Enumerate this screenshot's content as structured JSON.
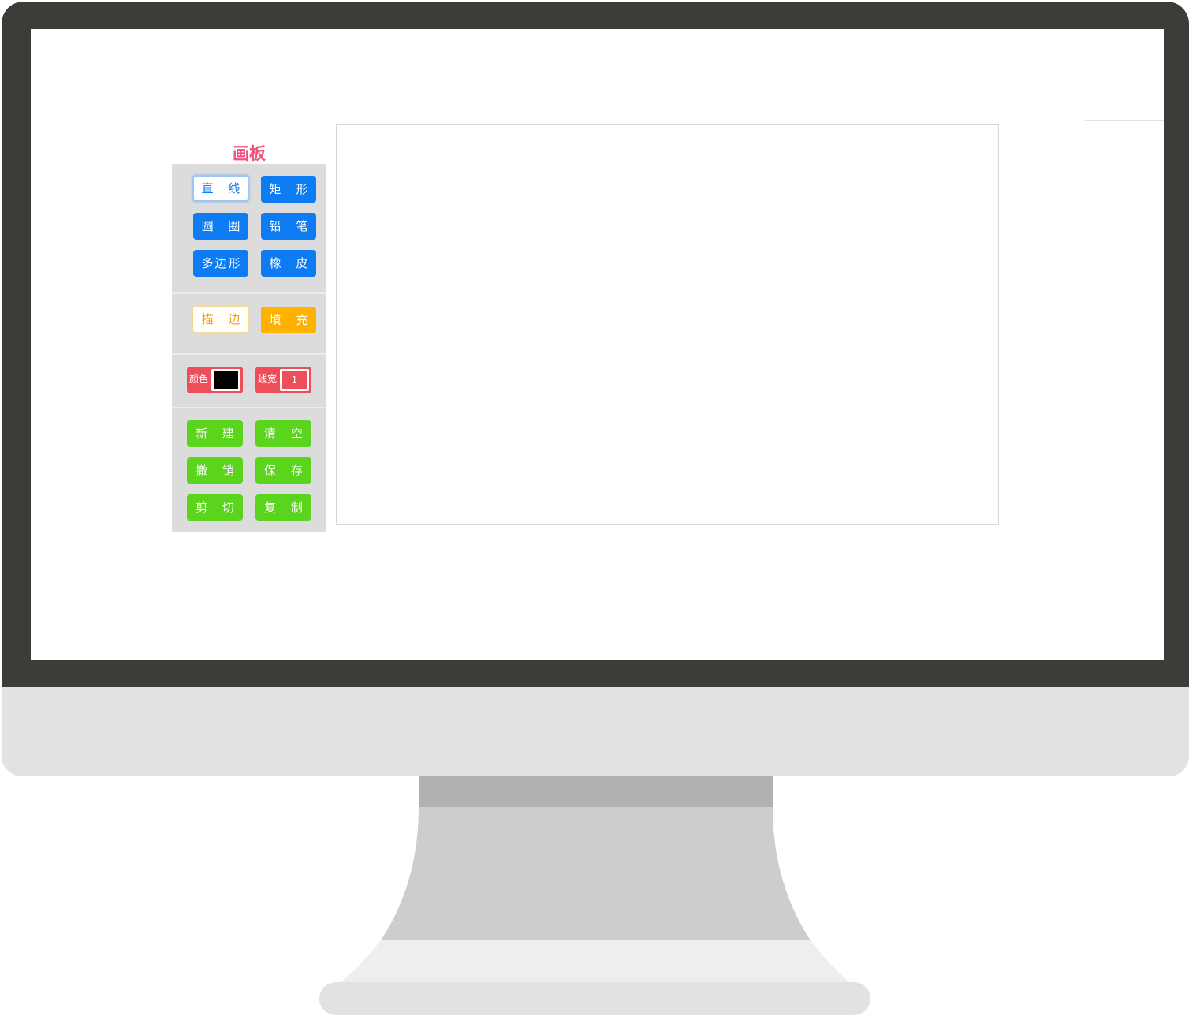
{
  "app": {
    "title": "画板"
  },
  "tools": [
    {
      "label": "直 线",
      "active": true
    },
    {
      "label": "矩 形"
    },
    {
      "label": "圆 圈"
    },
    {
      "label": "铅 笔"
    },
    {
      "label": "多边形"
    },
    {
      "label": "橡 皮"
    }
  ],
  "modes": [
    {
      "label": "描 边",
      "active": true
    },
    {
      "label": "填 充"
    }
  ],
  "settings": {
    "color_label": "颜色",
    "color_value": "#000000",
    "width_label": "线宽",
    "width_value": "1"
  },
  "actions": [
    {
      "label": "新 建"
    },
    {
      "label": "清 空"
    },
    {
      "label": "撤 销"
    },
    {
      "label": "保 存"
    },
    {
      "label": "剪 切"
    },
    {
      "label": "复 制"
    }
  ],
  "colors": {
    "bezel": "#3b3d38",
    "tool_blue": "#0d7cf2",
    "mode_orange": "#ffb100",
    "setting_red": "#ee4e5a",
    "action_green": "#5bd41d",
    "title_pink": "#f0507a"
  }
}
